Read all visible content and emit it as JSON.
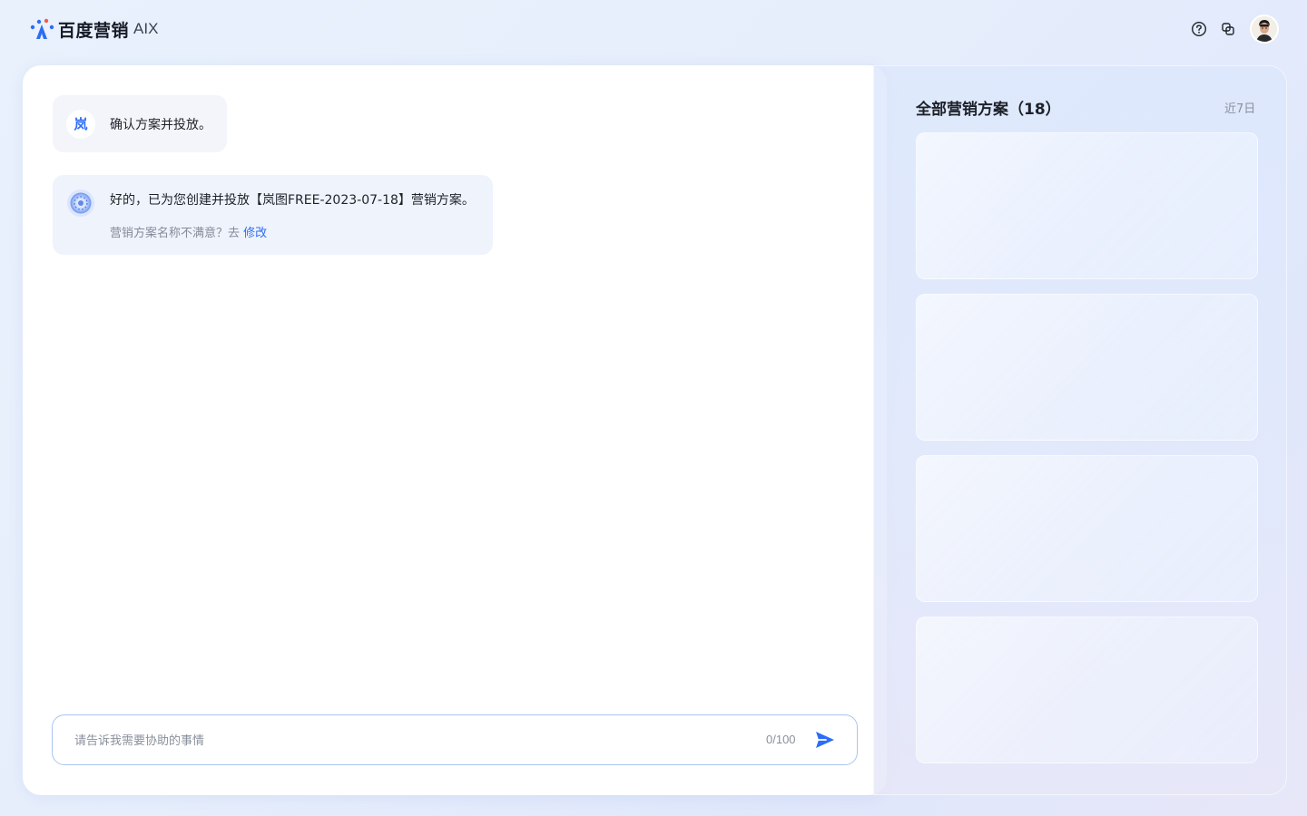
{
  "header": {
    "brand": "百度营销",
    "product": "AIX",
    "icons": [
      "baidu-marketing-logo-icon",
      "help-icon",
      "copy-icon",
      "user-avatar"
    ]
  },
  "chat": {
    "user_badge": "岚",
    "user_message": "确认方案并投放。",
    "bot_message": "好的，已为您创建并投放【岚图FREE-2023-07-18】营销方案。",
    "bot_hint": "营销方案名称不满意？去",
    "bot_link": "修改",
    "input_placeholder": "请告诉我需要协助的事情",
    "input_value": "",
    "counter": "0/100"
  },
  "plans": {
    "title": "全部营销方案（18）",
    "filter": "近7日"
  },
  "colors": {
    "accent": "#2d6df6",
    "text_primary": "#1f2329",
    "text_secondary": "#8a909c",
    "input_border": "#aac4f2"
  }
}
